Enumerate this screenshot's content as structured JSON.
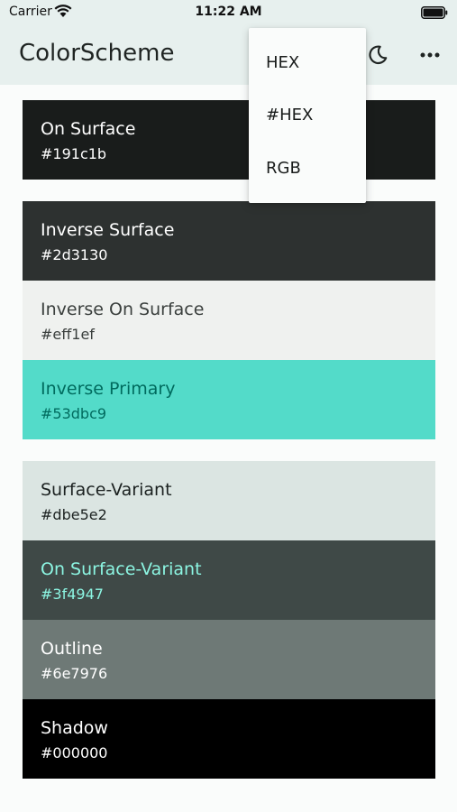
{
  "status_bar": {
    "carrier": "Carrier",
    "time": "11:22 AM",
    "wifi_icon": "wifi-icon",
    "battery_icon": "battery-icon"
  },
  "app_bar": {
    "title": "ColorScheme",
    "actions": [
      "moon-icon",
      "more-horizontal-icon"
    ]
  },
  "menu": {
    "items": [
      {
        "label": "HEX"
      },
      {
        "label": "#HEX"
      },
      {
        "label": "RGB"
      }
    ]
  },
  "colors": {
    "on_surface": {
      "name": "On Surface",
      "hex": "#191c1b",
      "bg": "#191c1b",
      "fg": "#ffffff"
    },
    "inverse_surface": {
      "name": "Inverse Surface",
      "hex": "#2d3130",
      "bg": "#2d3130",
      "fg": "#ffffff"
    },
    "inverse_on_surface": {
      "name": "Inverse On Surface",
      "hex": "#eff1ef",
      "bg": "#eff1ef",
      "fg": "#3a3f3d"
    },
    "inverse_primary": {
      "name": "Inverse Primary",
      "hex": "#53dbc9",
      "bg": "#53dbc9",
      "fg": "#006b5e"
    },
    "surface_variant": {
      "name": "Surface-Variant",
      "hex": "#dbe5e2",
      "bg": "#dbe5e2",
      "fg": "#1b2120"
    },
    "on_surface_variant": {
      "name": "On Surface-Variant",
      "hex": "#3f4947",
      "bg": "#3f4947",
      "fg": "#8cf5e2"
    },
    "outline": {
      "name": "Outline",
      "hex": "#6e7976",
      "bg": "#6e7976",
      "fg": "#ffffff"
    },
    "shadow": {
      "name": "Shadow",
      "hex": "#000000",
      "bg": "#000000",
      "fg": "#ffffff"
    }
  }
}
